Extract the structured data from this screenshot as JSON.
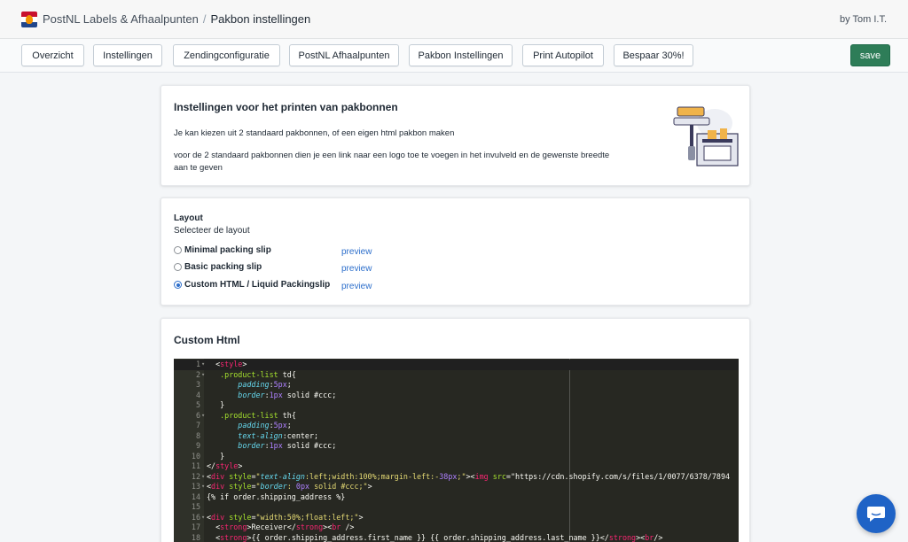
{
  "topbar": {
    "app_name": "PostNL Labels & Afhaalpunten",
    "separator": "/",
    "page_title": "Pakbon instellingen",
    "by": "by Tom I.T."
  },
  "nav": {
    "buttons": [
      "Overzicht",
      "Instellingen",
      "Zendingconfiguratie",
      "PostNL Afhaalpunten",
      "Pakbon Instellingen",
      "Print Autopilot",
      "Bespaar 30%!"
    ],
    "save_label": "save"
  },
  "intro": {
    "title": "Instellingen voor het printen van pakbonnen",
    "text1": "Je kan kiezen uit 2 standaard pakbonnen, of een eigen html pakbon maken",
    "text2_line1": "voor de 2 standaard pakbonnen dien je een link naar een logo toe te voegen in het invulveld en de gewenste breedte",
    "text2_line2": "aan te geven"
  },
  "layout": {
    "label": "Layout",
    "sublabel": "Selecteer de layout",
    "options": [
      {
        "label": "Minimal packing slip",
        "preview": "preview",
        "checked": false
      },
      {
        "label": "Basic packing slip",
        "preview": "preview",
        "checked": false
      },
      {
        "label": "Custom HTML / Liquid Packingslip",
        "preview": "preview",
        "checked": true
      }
    ]
  },
  "custom_html": {
    "title": "Custom Html",
    "lines": [
      {
        "n": "1",
        "fold": "▾",
        "code": "  <style>"
      },
      {
        "n": "2",
        "fold": "▾",
        "code": "   .product-list td{"
      },
      {
        "n": "3",
        "fold": "",
        "code": "       padding:5px;"
      },
      {
        "n": "4",
        "fold": "",
        "code": "       border:1px solid #ccc;"
      },
      {
        "n": "5",
        "fold": "",
        "code": "   }"
      },
      {
        "n": "6",
        "fold": "▾",
        "code": "   .product-list th{"
      },
      {
        "n": "7",
        "fold": "",
        "code": "       padding:5px;"
      },
      {
        "n": "8",
        "fold": "",
        "code": "       text-align:center;"
      },
      {
        "n": "9",
        "fold": "",
        "code": "       border:1px solid #ccc;"
      },
      {
        "n": "10",
        "fold": "",
        "code": "   }"
      },
      {
        "n": "11",
        "fold": "",
        "code": "</style>"
      },
      {
        "n": "12",
        "fold": "▾",
        "code": "<div style=\"text-align:left;width:100%;margin-left:-38px;\"><img src=\"https://cdn.shopify.com/s/files/1/0077/6378/7894"
      },
      {
        "n": "13",
        "fold": "▾",
        "code": "<div style=\"border: 0px solid #ccc;\">"
      },
      {
        "n": "14",
        "fold": "",
        "code": "{% if order.shipping_address %}"
      },
      {
        "n": "15",
        "fold": "",
        "code": ""
      },
      {
        "n": "16",
        "fold": "▾",
        "code": "<div style=\"width:50%;float:left;\">"
      },
      {
        "n": "17",
        "fold": "",
        "code": "  <strong>Receiver</strong><br />"
      },
      {
        "n": "18",
        "fold": "",
        "code": "  <strong>{{ order.shipping_address.first_name }} {{ order.shipping_address.last_name }}</strong><br/>"
      }
    ]
  },
  "colors": {
    "save_green": "#2e7d58",
    "link_blue": "#2c6ecb",
    "editor_bg": "#272822",
    "chat_blue": "#1f63c6"
  },
  "icons": [
    "app-logo-icon",
    "printer-illustration-icon",
    "chat-icon"
  ]
}
